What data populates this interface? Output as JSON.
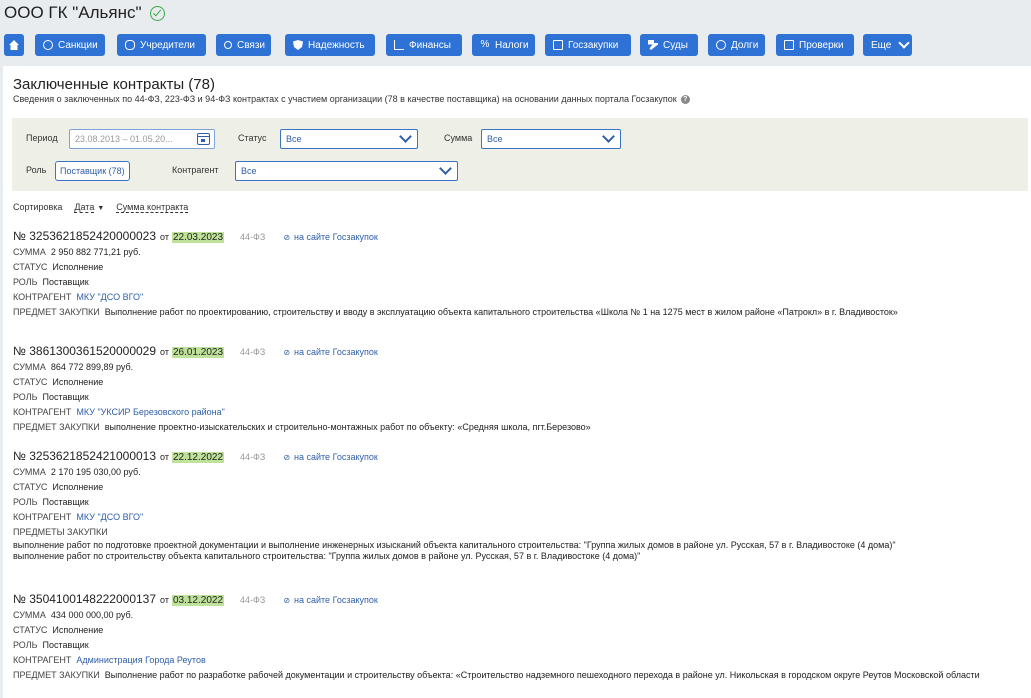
{
  "company": {
    "name": "ООО ГК \"Альянс\""
  },
  "nav": [
    {
      "label": "",
      "icon": "home-icon"
    },
    {
      "label": "Санкции",
      "icon": "globe-icon"
    },
    {
      "label": "Учредители",
      "icon": "users-icon"
    },
    {
      "label": "Связи",
      "icon": "network-icon"
    },
    {
      "label": "Надежность",
      "icon": "shield-icon"
    },
    {
      "label": "Финансы",
      "icon": "chart-icon"
    },
    {
      "label": "Налоги",
      "icon": "percent-icon"
    },
    {
      "label": "Госзакупки",
      "icon": "card-icon"
    },
    {
      "label": "Суды",
      "icon": "gavel-icon"
    },
    {
      "label": "Долги",
      "icon": "scales-icon"
    },
    {
      "label": "Проверки",
      "icon": "clipboard-icon"
    },
    {
      "label": "Еще",
      "icon": "chevron-down-icon"
    }
  ],
  "section": {
    "title": "Заключенные контракты (78)",
    "subtitle": "Сведения о заключенных по 44-ФЗ, 223-ФЗ и 94-ФЗ контрактах с участием организации (78 в качестве поставщика) на основании данных портала Госзакупок"
  },
  "filters": {
    "period_label": "Период",
    "period_value": "23.08.2013 – 01.05.20...",
    "status_label": "Статус",
    "status_value": "Все",
    "sum_label": "Сумма",
    "sum_value": "Все",
    "role_label": "Роль",
    "role_value": "Поставщик (78)",
    "counterparty_label": "Контрагент",
    "counterparty_value": "Все"
  },
  "sort": {
    "label": "Сортировка",
    "date": "Дата",
    "date_arrow": "▼",
    "sum": "Сумма контракта"
  },
  "labels": {
    "no": "№",
    "ot": "от",
    "link": "на сайте Госзакупок",
    "sum": "СУММА",
    "status": "СТАТУС",
    "role": "РОЛЬ",
    "counterparty": "КОНТРАГЕНТ",
    "subject": "ПРЕДМЕТ ЗАКУПКИ",
    "subjects": "ПРЕДМЕТЫ ЗАКУПКИ"
  },
  "contracts": [
    {
      "number": "3253621852420000023",
      "date": "22.03.2023",
      "law": "44-ФЗ",
      "sum": "2 950 882 771,21 руб.",
      "status": "Исполнение",
      "role": "Поставщик",
      "counterparty": "МКУ \"ДСО ВГО\"",
      "subject": "Выполнение работ по проектированию, строительству и вводу в эксплуатацию объекта капитального строительства «Школа № 1 на 1275 мест в жилом районе «Патрокл» в г. Владивосток»"
    },
    {
      "number": "3861300361520000029",
      "date": "26.01.2023",
      "law": "44-ФЗ",
      "sum": "864 772 899,89 руб.",
      "status": "Исполнение",
      "role": "Поставщик",
      "counterparty": "МКУ \"УКСИР Березовского района\"",
      "subject": "выполнение проектно-изыскательских и строительно-монтажных работ по объекту: «Средняя школа, пгт.Березово»"
    },
    {
      "number": "3253621852421000013",
      "date": "22.12.2022",
      "law": "44-ФЗ",
      "sum": "2 170 195 030,00 руб.",
      "status": "Исполнение",
      "role": "Поставщик",
      "counterparty": "МКУ \"ДСО ВГО\"",
      "subject_1": "выполнение работ по подготовке проектной документации и выполнение инженерных изысканий объекта капитального строительства: \"Группа жилых домов в районе ул. Русская, 57 в г. Владивостоке (4 дома)\"",
      "subject_2": "выполнение работ по строительству объекта капитального строительства: \"Группа жилых домов в районе ул. Русская, 57 в г. Владивостоке (4 дома)\""
    },
    {
      "number": "3504100148222000137",
      "date": "03.12.2022",
      "law": "44-ФЗ",
      "sum": "434 000 000,00 руб.",
      "status": "Исполнение",
      "role": "Поставщик",
      "counterparty": "Администрация Города Реутов",
      "subject": "Выполнение работ по разработке рабочей документации и строительству объекта: «Строительство надземного пешеходного перехода в районе ул. Никольская в городском округе Реутов Московской области"
    }
  ]
}
